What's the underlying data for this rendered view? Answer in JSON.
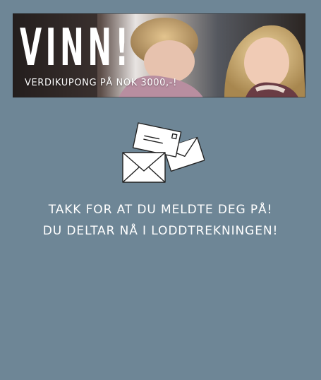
{
  "banner": {
    "title": "VINN!",
    "subtitle": "VERDIKUPONG PÅ NOK 3000,-!"
  },
  "message": {
    "line1": "TAKK FOR AT DU MELDTE DEG PÅ!",
    "line2": "DU DELTAR NÅ I LODDTREKNINGEN!"
  },
  "icons": {
    "envelopes": "envelopes-icon",
    "banner_photo": "children-photo"
  },
  "colors": {
    "background": "#6e8696",
    "text": "#ffffff"
  }
}
